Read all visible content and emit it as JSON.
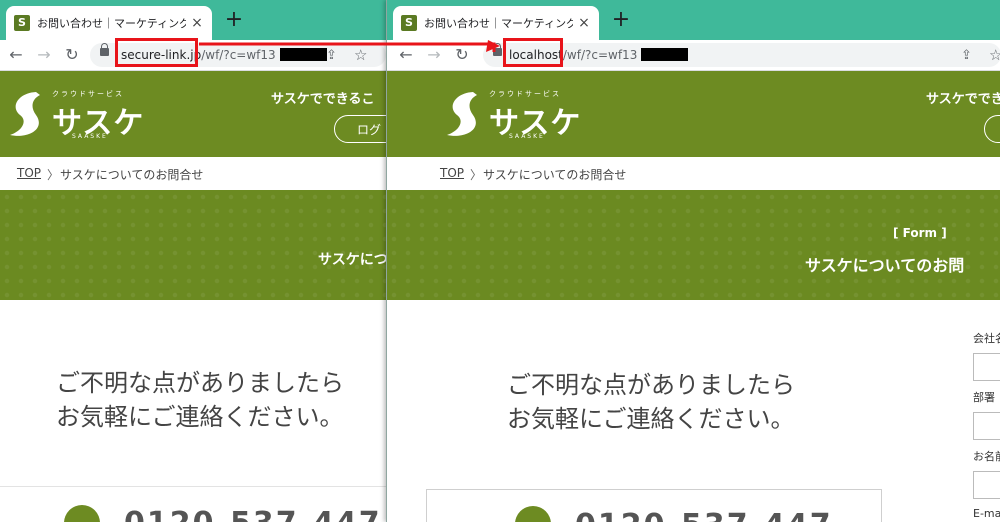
{
  "browser": {
    "tab_title": "お問い合わせ｜マーケティングオートメ",
    "favicon_letter": "S",
    "new_tab_glyph": "+",
    "close_glyph": "×",
    "left_url": {
      "host": "secure-link.jp",
      "path": "/wf/?c=wf13"
    },
    "right_url": {
      "host": "localhost",
      "path": "/wf/?c=wf13"
    }
  },
  "site": {
    "logo_kana": "クラウドサービス",
    "logo_text": "サスケ",
    "logo_sub": "SAASKE",
    "header_link": "サスケでできるこ",
    "login_label": "ログ"
  },
  "breadcrumb": {
    "top": "TOP",
    "separator": "〉",
    "current": "サスケについてのお問合せ"
  },
  "banner": {
    "form_label": "[ Form ]",
    "title_right": "サスケについてのお問",
    "title_left": "サスケにつ"
  },
  "content": {
    "lead_line1": "ご不明な点がありましたら",
    "lead_line2": "お気軽にご連絡ください。",
    "phone": "0120-537-447"
  },
  "form": {
    "labels": [
      "会社名",
      "部署",
      "お名前",
      "E-mail"
    ]
  },
  "colors": {
    "brand_green": "#6d8b22",
    "tab_strip": "#3fb99a",
    "highlight": "#e8141a"
  }
}
